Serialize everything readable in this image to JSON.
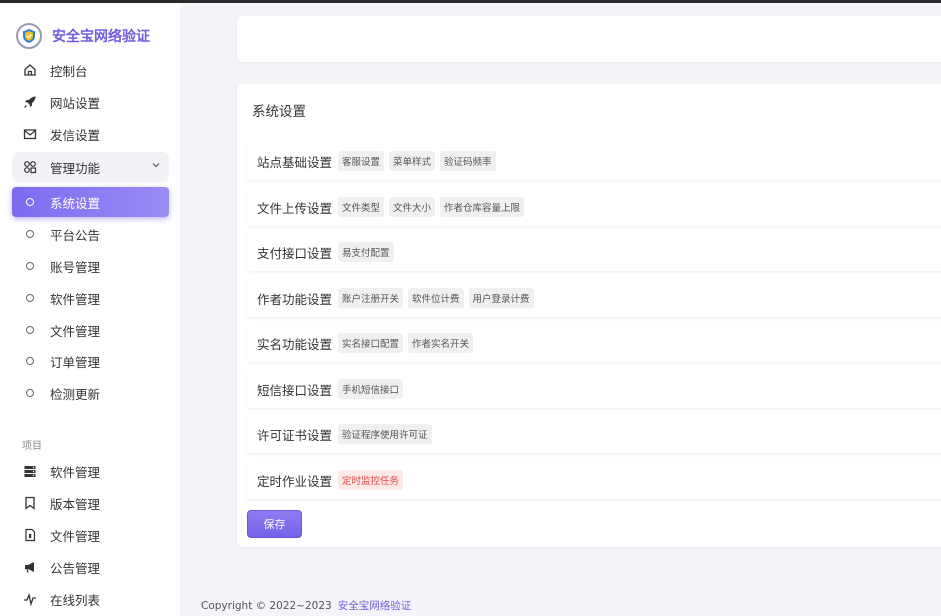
{
  "app": {
    "brand": "安全宝网络验证"
  },
  "sidebar": {
    "items": [
      {
        "label": "控制台",
        "icon": "home-icon"
      },
      {
        "label": "网站设置",
        "icon": "rocket-icon"
      },
      {
        "label": "发信设置",
        "icon": "mail-icon"
      },
      {
        "label": "管理功能",
        "icon": "apps-icon"
      }
    ],
    "sub_items": [
      {
        "label": "系统设置"
      },
      {
        "label": "平台公告"
      },
      {
        "label": "账号管理"
      },
      {
        "label": "软件管理"
      },
      {
        "label": "文件管理"
      },
      {
        "label": "订单管理"
      },
      {
        "label": "检测更新"
      }
    ],
    "section_label": "项目",
    "project_items": [
      {
        "label": "软件管理",
        "icon": "server-icon"
      },
      {
        "label": "版本管理",
        "icon": "bookmark-icon"
      },
      {
        "label": "文件管理",
        "icon": "file-icon"
      },
      {
        "label": "公告管理",
        "icon": "megaphone-icon"
      },
      {
        "label": "在线列表",
        "icon": "activity-icon"
      }
    ]
  },
  "main": {
    "title": "系统设置",
    "rows": [
      {
        "label": "站点基础设置",
        "tags": [
          "客服设置",
          "菜单样式",
          "验证码频率"
        ]
      },
      {
        "label": "文件上传设置",
        "tags": [
          "文件类型",
          "文件大小",
          "作者仓库容量上限"
        ]
      },
      {
        "label": "支付接口设置",
        "tags": [
          "易支付配置"
        ]
      },
      {
        "label": "作者功能设置",
        "tags": [
          "账户注册开关",
          "软件位计费",
          "用户登录计费"
        ]
      },
      {
        "label": "实名功能设置",
        "tags": [
          "实名接口配置",
          "作者实名开关"
        ]
      },
      {
        "label": "短信接口设置",
        "tags": [
          "手机短信接口"
        ]
      },
      {
        "label": "许可证书设置",
        "tags": [
          "验证程序使用许可证"
        ]
      },
      {
        "label": "定时作业设置",
        "tags": [
          "定时监控任务"
        ]
      }
    ],
    "save_label": "保存"
  },
  "footer": {
    "copyright": "Copyright © 2022~2023",
    "link": "安全宝网络验证"
  },
  "colors": {
    "accent": "#7d6bf0",
    "danger": "#e24a4a"
  }
}
